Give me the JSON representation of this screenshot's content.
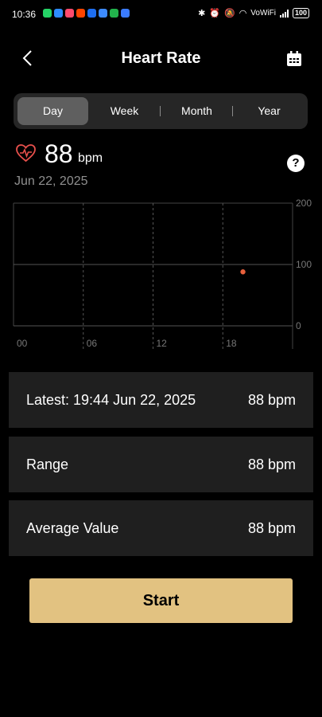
{
  "status_bar": {
    "time": "10:36",
    "notification_icons": [
      {
        "name": "whatsapp-icon",
        "color": "#25d366"
      },
      {
        "name": "youtube-icon",
        "color": "#2d8cff"
      },
      {
        "name": "app-icon",
        "color": "#ff4b6e"
      },
      {
        "name": "reddit-icon",
        "color": "#ff4500"
      },
      {
        "name": "jio-icon",
        "color": "#1e6ff2"
      },
      {
        "name": "mail-icon",
        "color": "#3d8bff"
      },
      {
        "name": "app-icon",
        "color": "#22b34c"
      },
      {
        "name": "app-icon",
        "color": "#3b7cff"
      }
    ],
    "vowifi": "VoWiFi",
    "battery": "100"
  },
  "header": {
    "title": "Heart Rate"
  },
  "tabs": [
    {
      "label": "Day",
      "active": true
    },
    {
      "label": "Week",
      "active": false
    },
    {
      "label": "Month",
      "active": false
    },
    {
      "label": "Year",
      "active": false
    }
  ],
  "summary": {
    "value": "88",
    "unit": "bpm",
    "date": "Jun 22, 2025"
  },
  "chart_data": {
    "type": "scatter",
    "x_ticks": [
      "00",
      "06",
      "12",
      "18"
    ],
    "y_ticks": [
      "200",
      "100",
      "0"
    ],
    "xlim": [
      0,
      24
    ],
    "ylim": [
      0,
      200
    ],
    "points": [
      {
        "x": 19.73,
        "y": 88
      }
    ],
    "point_color": "#e8603c",
    "grid": true
  },
  "stats": [
    {
      "label": "Latest: 19:44 Jun 22, 2025",
      "value": "88 bpm"
    },
    {
      "label": "Range",
      "value": "88 bpm"
    },
    {
      "label": "Average Value",
      "value": "88 bpm"
    }
  ],
  "start_button": {
    "label": "Start"
  },
  "colors": {
    "accent": "#e2c281",
    "heart": "#e8504c"
  }
}
